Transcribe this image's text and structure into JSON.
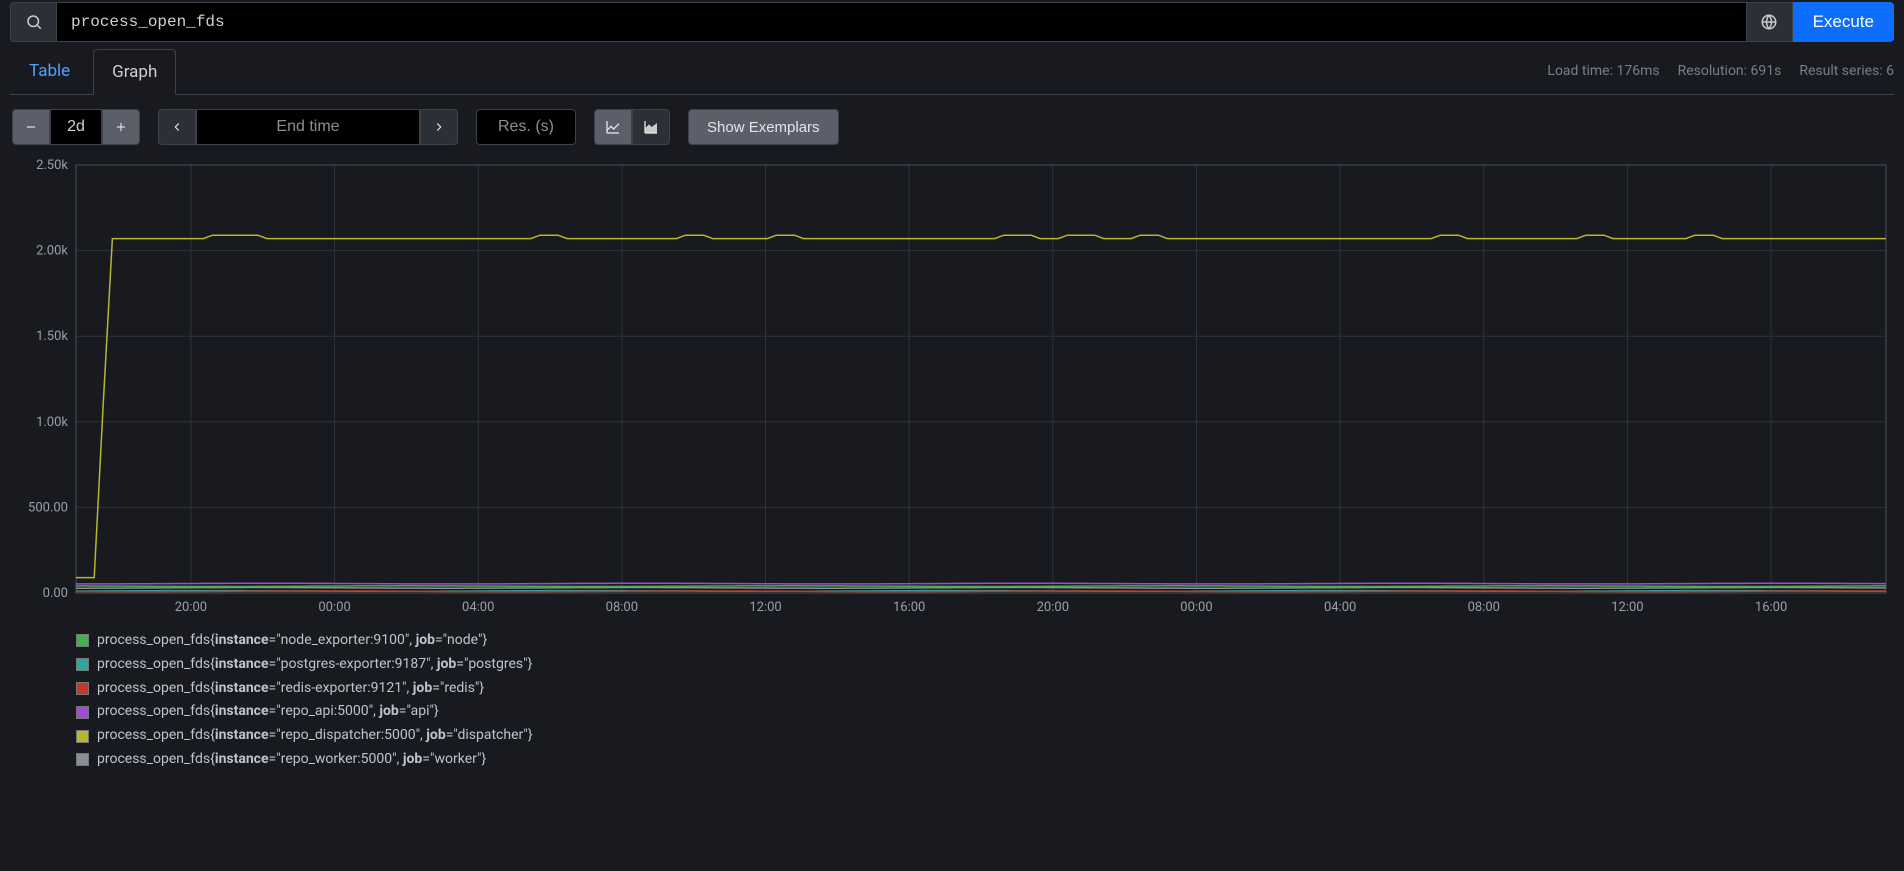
{
  "query": {
    "value": "process_open_fds"
  },
  "execute_label": "Execute",
  "tabs": {
    "table": "Table",
    "graph": "Graph"
  },
  "status": {
    "load_time": "Load time: 176ms",
    "resolution": "Resolution: 691s",
    "result_series": "Result series: 6"
  },
  "controls": {
    "range": "2d",
    "endtime_placeholder": "End time",
    "res_placeholder": "Res. (s)",
    "exemplars": "Show Exemplars"
  },
  "chart_data": {
    "type": "line",
    "ylabel": "",
    "ylim": [
      0,
      2500
    ],
    "y_ticks": [
      0,
      500,
      1000,
      1500,
      2000,
      2500
    ],
    "y_tick_labels": [
      "0.00",
      "500.00",
      "1.00k",
      "1.50k",
      "2.00k",
      "2.50k"
    ],
    "x_ticks": [
      "20:00",
      "00:00",
      "04:00",
      "08:00",
      "12:00",
      "16:00",
      "20:00",
      "00:00",
      "04:00",
      "08:00",
      "12:00",
      "16:00"
    ],
    "x_range_hours": 48,
    "series": [
      {
        "name": "node",
        "color": "#3fb24f",
        "metric": "process_open_fds",
        "labels": {
          "instance": "node_exporter:9100",
          "job": "node"
        },
        "approx_value": 40
      },
      {
        "name": "postgres",
        "color": "#2aa9a1",
        "metric": "process_open_fds",
        "labels": {
          "instance": "postgres-exporter:9187",
          "job": "postgres"
        },
        "approx_value": 12
      },
      {
        "name": "redis",
        "color": "#c0392b",
        "metric": "process_open_fds",
        "labels": {
          "instance": "redis-exporter:9121",
          "job": "redis"
        },
        "approx_value": 10
      },
      {
        "name": "api",
        "color": "#a04bd6",
        "metric": "process_open_fds",
        "labels": {
          "instance": "repo_api:5000",
          "job": "api"
        },
        "approx_value": 55
      },
      {
        "name": "dispatcher",
        "color": "#b5b82f",
        "metric": "process_open_fds",
        "labels": {
          "instance": "repo_dispatcher:5000",
          "job": "dispatcher"
        },
        "approx_value": 2080,
        "initial_value": 90
      },
      {
        "name": "worker",
        "color": "#8a8e97",
        "metric": "process_open_fds",
        "labels": {
          "instance": "repo_worker:5000",
          "job": "worker"
        },
        "approx_value": 30
      }
    ]
  },
  "legend": [
    {
      "color": "#3fb24f",
      "pre": "process_open_fds{",
      "k1": "instance",
      "v1": "=\"node_exporter:9100\", ",
      "k2": "job",
      "v2": "=\"node\"}"
    },
    {
      "color": "#2aa9a1",
      "pre": "process_open_fds{",
      "k1": "instance",
      "v1": "=\"postgres-exporter:9187\", ",
      "k2": "job",
      "v2": "=\"postgres\"}"
    },
    {
      "color": "#c0392b",
      "pre": "process_open_fds{",
      "k1": "instance",
      "v1": "=\"redis-exporter:9121\", ",
      "k2": "job",
      "v2": "=\"redis\"}"
    },
    {
      "color": "#a04bd6",
      "pre": "process_open_fds{",
      "k1": "instance",
      "v1": "=\"repo_api:5000\", ",
      "k2": "job",
      "v2": "=\"api\"}"
    },
    {
      "color": "#b5b82f",
      "pre": "process_open_fds{",
      "k1": "instance",
      "v1": "=\"repo_dispatcher:5000\", ",
      "k2": "job",
      "v2": "=\"dispatcher\"}"
    },
    {
      "color": "#8a8e97",
      "pre": "process_open_fds{",
      "k1": "instance",
      "v1": "=\"repo_worker:5000\", ",
      "k2": "job",
      "v2": "=\"worker\"}"
    }
  ]
}
